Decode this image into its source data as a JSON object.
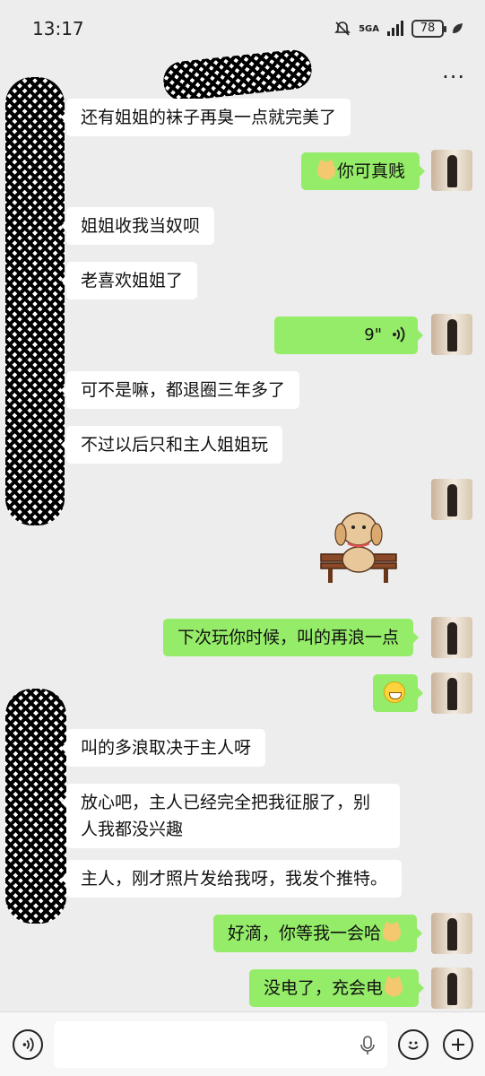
{
  "status_bar": {
    "time": "13:17",
    "network": "5GA",
    "battery": "78"
  },
  "header": {
    "more": "···"
  },
  "messages": [
    {
      "side": "left",
      "text": "还有姐姐的袜子再臭一点就完美了"
    },
    {
      "side": "right",
      "emoji": "cat-emoji",
      "text": "你可真贱"
    },
    {
      "side": "left",
      "text": "姐姐收我当奴呗"
    },
    {
      "side": "left",
      "text": "老喜欢姐姐了"
    },
    {
      "side": "right",
      "type": "voice",
      "text": "9\""
    },
    {
      "side": "left",
      "text": "可不是嘛，都退圈三年多了"
    },
    {
      "side": "left",
      "text": "不过以后只和主人姐姐玩"
    },
    {
      "side": "right",
      "type": "sticker",
      "sticker": "dog-on-bench-sticker"
    },
    {
      "side": "right",
      "text": "下次玩你时候，叫的再浪一点"
    },
    {
      "side": "right",
      "type": "emoji",
      "emoji": "grin-emoji"
    },
    {
      "side": "left",
      "text": "叫的多浪取决于主人呀"
    },
    {
      "side": "left",
      "text": "放心吧，主人已经完全把我征服了，别人我都没兴趣"
    },
    {
      "side": "left",
      "text": "主人，刚才照片发给我呀，我发个推特。"
    },
    {
      "side": "right",
      "text": "好滴，你等我一会哈",
      "emoji": "cat-emoji"
    },
    {
      "side": "right",
      "text": "没电了，充会电",
      "emoji": "cat-emoji"
    }
  ],
  "input_bar": {
    "placeholder": ""
  }
}
